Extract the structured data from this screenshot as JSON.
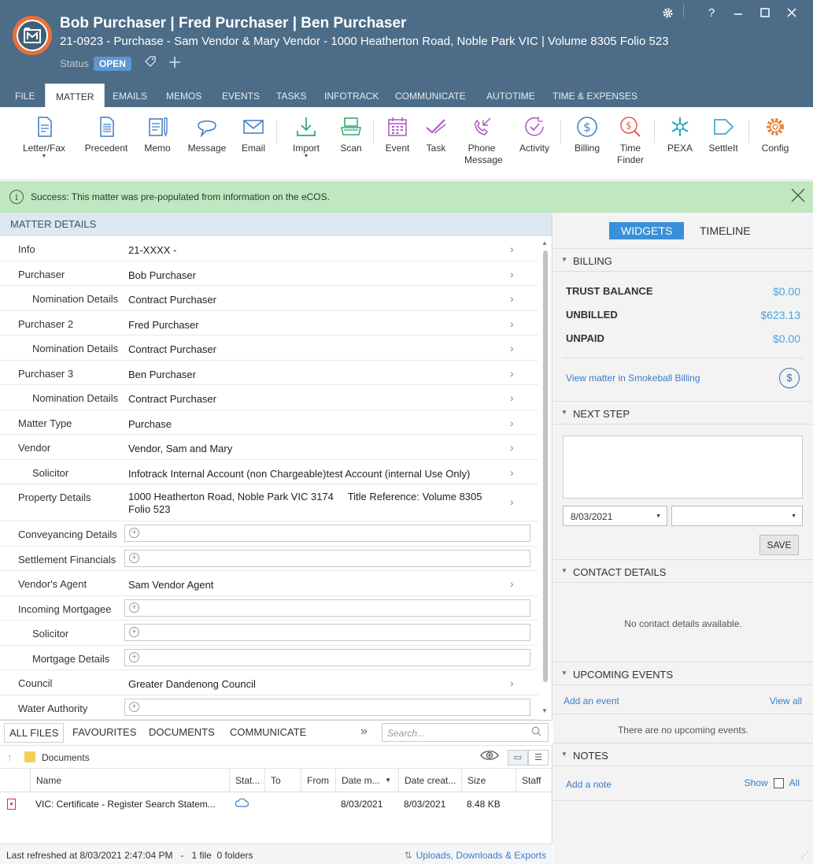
{
  "header": {
    "title": "Bob Purchaser | Fred Purchaser | Ben Purchaser",
    "subtitle": "21-0923 - Purchase - Sam Vendor & Mary Vendor - 1000 Heatherton Road, Noble Park VIC | Volume 8305 Folio 523",
    "status_label": "Status",
    "status_value": "OPEN",
    "accent_color": "#4d6c87",
    "badge_color": "#5b97d1"
  },
  "window_controls": [
    "gear-icon",
    "help-icon",
    "minimize-icon",
    "maximize-icon",
    "close-icon"
  ],
  "window_glyphs": {
    "help": "?"
  },
  "tabs": [
    {
      "label": "FILE"
    },
    {
      "label": "MATTER",
      "active": true
    },
    {
      "label": "EMAILS"
    },
    {
      "label": "MEMOS"
    },
    {
      "label": "EVENTS"
    },
    {
      "label": "TASKS"
    },
    {
      "label": "INFOTRACK"
    },
    {
      "label": "COMMUNICATE"
    },
    {
      "label": "AUTOTIME"
    },
    {
      "label": "TIME & EXPENSES"
    }
  ],
  "ribbon": {
    "letter_fax": "Letter/Fax",
    "precedent": "Precedent",
    "memo": "Memo",
    "message": "Message",
    "email": "Email",
    "import": "Import",
    "scan": "Scan",
    "event": "Event",
    "task": "Task",
    "phone_message_1": "Phone",
    "phone_message_2": "Message",
    "activity": "Activity",
    "billing": "Billing",
    "time_finder_1": "Time",
    "time_finder_2": "Finder",
    "pexa": "PEXA",
    "settleit": "SettleIt",
    "config": "Config"
  },
  "success_bar": {
    "icon_glyph": "i",
    "message": "Success: This matter was pre-populated from information on the eCOS.",
    "color": "#bfe7c0"
  },
  "matter_details": {
    "heading": "MATTER DETAILS",
    "rows": [
      {
        "label": "Info",
        "value": "21-XXXX -"
      },
      {
        "label": "Purchaser",
        "value": "Bob Purchaser"
      },
      {
        "label": "Nomination Details",
        "value": "Contract Purchaser"
      },
      {
        "label": "Purchaser 2",
        "value": "Fred Purchaser"
      },
      {
        "label": "Nomination Details",
        "value": "Contract Purchaser"
      },
      {
        "label": "Purchaser 3",
        "value": "Ben Purchaser"
      },
      {
        "label": "Nomination Details",
        "value": "Contract Purchaser"
      },
      {
        "label": "Matter Type",
        "value": "Purchase"
      },
      {
        "label": "Vendor",
        "value": "Vendor, Sam and Mary"
      },
      {
        "label": "Solicitor",
        "value": "Infotrack Internal Account (non Chargeable)test Account (internal Use Only)"
      },
      {
        "label": "Property Details",
        "value": "1000 Heatherton Road, Noble Park VIC 3174     Title Reference: Volume 8305 Folio 523"
      },
      {
        "label": "Conveyancing Details",
        "value": ""
      },
      {
        "label": "Settlement Financials",
        "value": ""
      },
      {
        "label": "Vendor's Agent",
        "value": "Sam Vendor Agent"
      },
      {
        "label": "Incoming Mortgagee",
        "value": ""
      },
      {
        "label": "Solicitor",
        "value": ""
      },
      {
        "label": "Mortgage Details",
        "value": ""
      },
      {
        "label": "Council",
        "value": "Greater Dandenong Council"
      },
      {
        "label": "Water Authority",
        "value": ""
      }
    ]
  },
  "files": {
    "tabs": [
      "ALL FILES",
      "FAVOURITES",
      "DOCUMENTS",
      "COMMUNICATE"
    ],
    "search_placeholder": "Search...",
    "path": "Documents",
    "columns": [
      "Name",
      "Stat...",
      "To",
      "From",
      "Date m...",
      "Date creat...",
      "Size",
      "Staff"
    ],
    "rows": [
      {
        "name": "VIC: Certificate - Register Search Statem...",
        "status_icon": "cloud-icon",
        "to": "",
        "from": "",
        "date_modified": "8/03/2021",
        "date_created": "8/03/2021",
        "size": "8.48 KB",
        "staff": ""
      }
    ],
    "status_left": "Last refreshed at 8/03/2021 2:47:04 PM   -   1 file  0 folders",
    "status_right": "Uploads, Downloads & Exports"
  },
  "widgets": {
    "tab_widgets": "WIDGETS",
    "tab_timeline": "TIMELINE",
    "billing": {
      "heading": "BILLING",
      "trust_label": "TRUST BALANCE",
      "trust_value": "$0.00",
      "unbilled_label": "UNBILLED",
      "unbilled_value": "$623.13",
      "unpaid_label": "UNPAID",
      "unpaid_value": "$0.00",
      "link": "View matter in Smokeball Billing"
    },
    "next_step": {
      "heading": "NEXT STEP",
      "date": "8/03/2021",
      "second_select": "",
      "save_label": "SAVE"
    },
    "contact_details": {
      "heading": "CONTACT DETAILS",
      "empty": "No contact details available."
    },
    "upcoming_events": {
      "heading": "UPCOMING EVENTS",
      "add_link": "Add an event",
      "view_all": "View all",
      "empty": "There are no upcoming events."
    },
    "notes": {
      "heading": "NOTES",
      "add_link": "Add a note",
      "show_label": "Show",
      "all_label": "All"
    }
  }
}
